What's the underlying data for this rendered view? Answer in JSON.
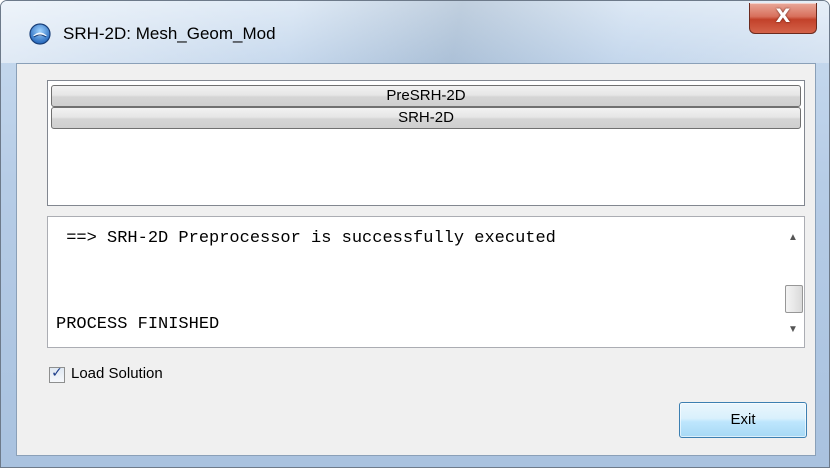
{
  "window": {
    "title": "SRH-2D: Mesh_Geom_Mod",
    "app_icon": "srh-app-icon",
    "close_icon": "close-icon",
    "close_glyph": "X"
  },
  "program_list": {
    "items": [
      {
        "label": "PreSRH-2D"
      },
      {
        "label": "SRH-2D"
      }
    ]
  },
  "output": {
    "lines": [
      " ==> SRH-2D Preprocessor is successfully executed",
      "PROCESS FINISHED"
    ],
    "scroll_up_glyph": "▲",
    "scroll_down_glyph": "▼"
  },
  "load_solution": {
    "label": "Load Solution",
    "checked": true,
    "check_glyph": "✓"
  },
  "exit_button": {
    "label": "Exit"
  },
  "colors": {
    "accent": "#3c7fb1",
    "close_red": "#c2412a"
  }
}
